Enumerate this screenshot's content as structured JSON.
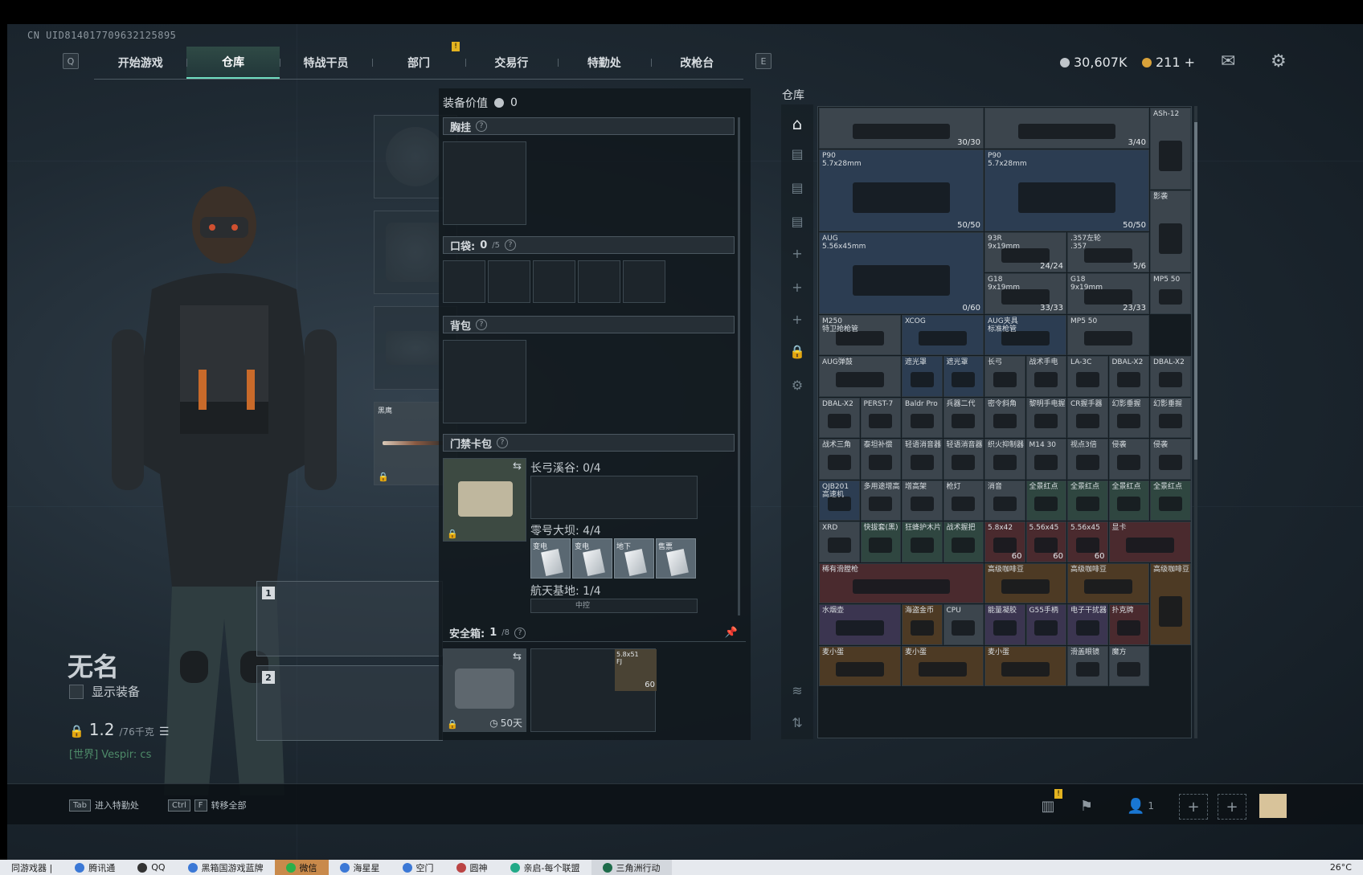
{
  "uid": "CN UID814017709632125895",
  "nav": {
    "left_key": "Q",
    "right_key": "E",
    "tabs": [
      "开始游戏",
      "仓库",
      "特战干员",
      "部门",
      "交易行",
      "特勤处",
      "改枪台"
    ],
    "active_index": 1,
    "marker": "!"
  },
  "currency": {
    "havoc": "30,607K",
    "bond": "211 +"
  },
  "icons": {
    "mail": "mail-icon",
    "settings": "gear-icon"
  },
  "loadout": {
    "melee_label": "黑鹰",
    "slot1_num": "1",
    "slot2_num": "2"
  },
  "player": {
    "name": "无名",
    "show_equipment": "显示装备",
    "value": "1.2",
    "value_max": "/76千克",
    "chat": "[世界] Vespir: cs"
  },
  "mid": {
    "equip_value_label": "装备价值",
    "equip_value": "0",
    "chest_label": "胸挂",
    "pocket_label": "口袋:",
    "pocket_value": "0",
    "pocket_max": "/5",
    "backpack_label": "背包",
    "keycard_label": "门禁卡包",
    "map1": "长弓溪谷: 0/4",
    "map2": "零号大坝: 4/4",
    "map3": "航天基地: 1/4",
    "map3_partial": "中控",
    "cards": [
      "变电",
      "变电",
      "地下",
      "售票"
    ],
    "safe_label": "安全箱:",
    "safe_value": "1",
    "safe_max": "/8",
    "safe_days": "50天",
    "safe_item_name": "5.8x51\nFJ",
    "safe_item_count": "60"
  },
  "stash": {
    "title": "仓库",
    "items": [
      {
        "n": "",
        "c": "30/30"
      },
      {
        "n": "",
        "c": "3/40"
      },
      {
        "n": "ASh-12",
        "c": ""
      },
      {
        "n": "P90\n5.7x28mm",
        "c": "50/50"
      },
      {
        "n": "P90\n5.7x28mm",
        "c": "50/50"
      },
      {
        "n": "影袭",
        "c": ""
      },
      {
        "n": "AUG\n5.56x45mm",
        "c": "0/60"
      },
      {
        "n": "93R\n9x19mm",
        "c": "24/24"
      },
      {
        "n": ".357左轮\n.357",
        "c": "5/6"
      },
      {
        "n": "MP5 50",
        "c": ""
      },
      {
        "n": "G18\n9x19mm",
        "c": "33/33"
      },
      {
        "n": "G18\n9x19mm",
        "c": "23/33"
      },
      {
        "n": "M250\n特卫抢枪管",
        "c": ""
      },
      {
        "n": "XCOG",
        "c": ""
      },
      {
        "n": "AUG夹具\n标准枪管",
        "c": ""
      },
      {
        "n": "MP5 50",
        "c": ""
      },
      {
        "n": "AUG弹鼓",
        "c": ""
      },
      {
        "n": "遮光罩",
        "c": ""
      },
      {
        "n": "遮光罩",
        "c": ""
      },
      {
        "n": "长弓",
        "c": ""
      },
      {
        "n": "战术手电",
        "c": ""
      },
      {
        "n": "LA-3C",
        "c": ""
      },
      {
        "n": "DBAL-X2",
        "c": ""
      },
      {
        "n": "DBAL-X2",
        "c": ""
      },
      {
        "n": "DBAL-X2",
        "c": ""
      },
      {
        "n": "PERST-7",
        "c": ""
      },
      {
        "n": "Baldr Pro",
        "c": ""
      },
      {
        "n": "兵器二代",
        "c": ""
      },
      {
        "n": "密令斜角",
        "c": ""
      },
      {
        "n": "黎明手电握",
        "c": ""
      },
      {
        "n": "CR握手器",
        "c": ""
      },
      {
        "n": "幻影垂握",
        "c": ""
      },
      {
        "n": "幻影垂握",
        "c": ""
      },
      {
        "n": "战术三角",
        "c": ""
      },
      {
        "n": "泰坦补偿",
        "c": ""
      },
      {
        "n": "轻语消音器",
        "c": ""
      },
      {
        "n": "轻语消音器",
        "c": ""
      },
      {
        "n": "织火抑制器",
        "c": ""
      },
      {
        "n": "M14 30",
        "c": ""
      },
      {
        "n": "视点3倍",
        "c": ""
      },
      {
        "n": "侵袭",
        "c": ""
      },
      {
        "n": "侵袭",
        "c": ""
      },
      {
        "n": "QJB201\n高速机",
        "c": ""
      },
      {
        "n": "多用途增高",
        "c": ""
      },
      {
        "n": "增高架",
        "c": ""
      },
      {
        "n": "枪灯",
        "c": ""
      },
      {
        "n": "消音",
        "c": ""
      },
      {
        "n": "全景红点",
        "c": ""
      },
      {
        "n": "全景红点",
        "c": ""
      },
      {
        "n": "全景红点",
        "c": ""
      },
      {
        "n": "全景红点",
        "c": ""
      },
      {
        "n": "XRD",
        "c": ""
      },
      {
        "n": "快拔套(黑)",
        "c": ""
      },
      {
        "n": "狂蜂护木片",
        "c": ""
      },
      {
        "n": "战术握把",
        "c": ""
      },
      {
        "n": "5.8x42",
        "c": "60"
      },
      {
        "n": "5.56x45",
        "c": "60"
      },
      {
        "n": "5.56x45",
        "c": "60"
      },
      {
        "n": "显卡",
        "c": ""
      },
      {
        "n": "稀有滑膛枪",
        "c": ""
      },
      {
        "n": "高级咖啡豆",
        "c": ""
      },
      {
        "n": "高级咖啡豆",
        "c": ""
      },
      {
        "n": "高级咖啡豆",
        "c": ""
      },
      {
        "n": "水烟壶",
        "c": ""
      },
      {
        "n": "海盗金币",
        "c": ""
      },
      {
        "n": "CPU",
        "c": ""
      },
      {
        "n": "能量凝胶",
        "c": ""
      },
      {
        "n": "G55手柄",
        "c": ""
      },
      {
        "n": "电子干扰器",
        "c": ""
      },
      {
        "n": "扑克牌",
        "c": ""
      },
      {
        "n": "麦小蛋",
        "c": ""
      },
      {
        "n": "麦小蛋",
        "c": ""
      },
      {
        "n": "麦小蛋",
        "c": ""
      },
      {
        "n": "滑盖眼镜",
        "c": ""
      },
      {
        "n": "魔方",
        "c": ""
      }
    ]
  },
  "bottom": {
    "hint1_key": "Tab",
    "hint1": "进入特勤处",
    "hint2_key1": "Ctrl",
    "hint2_key2": "F",
    "hint2": "转移全部",
    "friend_count": "1",
    "marker": "!"
  },
  "taskbar": {
    "items": [
      "同游戏器 |",
      "腾讯通",
      "QQ",
      "黑箱国游戏蓝牌",
      "微信",
      "海星星",
      "空门",
      "圆神",
      "亲启-每个联盟",
      "三角洲行动"
    ],
    "active_index": 4,
    "temp": "26°C"
  }
}
